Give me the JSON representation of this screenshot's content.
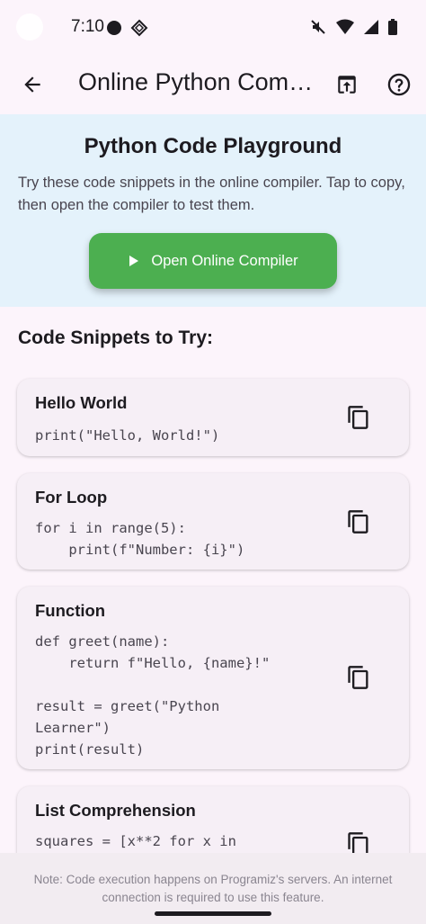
{
  "status_bar": {
    "time": "7:10"
  },
  "app_bar": {
    "title": "Online Python Com…"
  },
  "hero": {
    "title": "Python Code Playground",
    "description": "Try these code snippets in the online compiler. Tap to copy, then open the compiler to test them.",
    "open_button_label": "Open Online Compiler"
  },
  "snippets_heading": "Code Snippets to Try:",
  "snippets": [
    {
      "title": "Hello World",
      "code": "print(\"Hello, World!\")"
    },
    {
      "title": "For Loop",
      "code": "for i in range(5):\n    print(f\"Number: {i}\")"
    },
    {
      "title": "Function",
      "code": "def greet(name):\n    return f\"Hello, {name}!\"\n\nresult = greet(\"Python\nLearner\")\nprint(result)"
    },
    {
      "title": "List Comprehension",
      "code": "squares = [x**2 for x in"
    }
  ],
  "footer": {
    "note": "Note: Code execution happens on Programiz's servers. An internet connection is required to use this feature."
  }
}
